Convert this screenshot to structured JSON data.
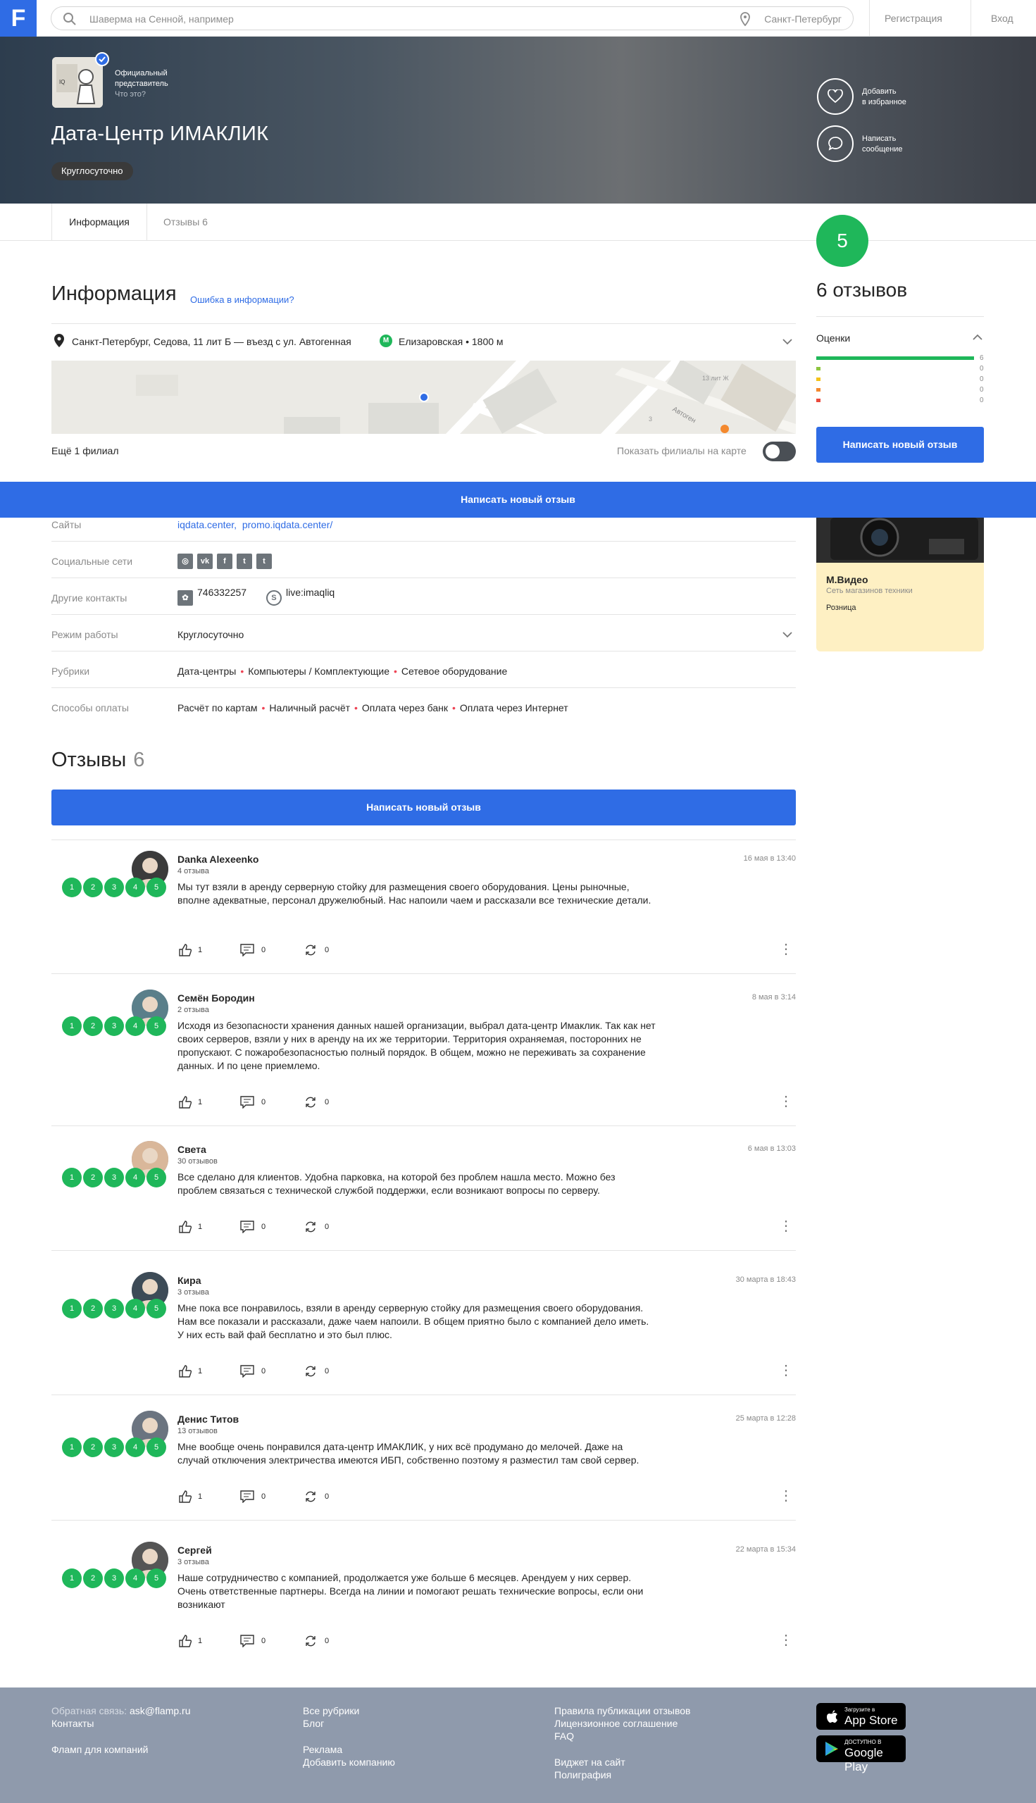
{
  "header": {
    "logo": "F",
    "search_placeholder": "Шаверма на Сенной, например",
    "city": "Санкт-Петербург",
    "register": "Регистрация",
    "login": "Вход"
  },
  "hero": {
    "official_line1": "Официальный",
    "official_line2": "представитель",
    "official_q": "Что это?",
    "title": "Дата-Центр ИМАКЛИК",
    "badge": "Круглосуточно",
    "fav_line1": "Добавить",
    "fav_line2": "в избранное",
    "msg_line1": "Написать",
    "msg_line2": "сообщение"
  },
  "tabs": {
    "info": "Информация",
    "reviews": "Отзывы 6"
  },
  "rating": {
    "score": "5",
    "count_text": "6 отзывов",
    "ocenki": "Оценки",
    "bars": [
      {
        "value": 6,
        "color": "#1fb75a"
      },
      {
        "value": 0,
        "color": "#8dc53e"
      },
      {
        "value": 0,
        "color": "#f4c219"
      },
      {
        "value": 0,
        "color": "#f4892e"
      },
      {
        "value": 0,
        "color": "#ea4a3c"
      }
    ],
    "write": "Написать новый отзыв"
  },
  "info": {
    "heading": "Информация",
    "error_link": "Ошибка в информации?",
    "address": "Санкт-Петербург, Седова, 11 лит Б — въезд с ул. Автогенная",
    "metro_letter": "М",
    "metro": "Елизаровская • 1800 м",
    "map_labels": {
      "lit": "13 лит Ж",
      "street": "Автоген",
      "num": "3"
    },
    "more_branch": "Ещё 1 филиал",
    "show_branches": "Показать филиалы на карте"
  },
  "sticky_write": "Написать новый отзыв",
  "details": {
    "sites_label": "Сайты",
    "site1": "iqdata.center,",
    "site2": "promo.iqdata.center/",
    "social_label": "Социальные сети",
    "social_icons": [
      "instagram-icon",
      "vk-icon",
      "facebook-icon",
      "twitter-icon",
      "twitter-icon"
    ],
    "contacts_label": "Другие контакты",
    "icq": "746332257",
    "skype": "live:imaqliq",
    "hours_label": "Режим работы",
    "hours": "Круглосуточно",
    "rubrics_label": "Рубрики",
    "rubrics": [
      "Дата-центры",
      "Компьютеры / Комплектующие",
      "Сетевое оборудование"
    ],
    "pay_label": "Способы оплаты",
    "payments": [
      "Расчёт по картам",
      "Наличный расчёт",
      "Оплата через банк",
      "Оплата через Интернет"
    ]
  },
  "ad": {
    "name": "М.Видео",
    "sub": "Сеть магазинов техники",
    "tag": "Розница"
  },
  "reviews": {
    "heading": "Отзывы",
    "count": "6",
    "write": "Написать новый отзыв",
    "items": [
      {
        "name": "Danka Alexeenko",
        "count": "4 отзыва",
        "date": "16 мая в 13:40",
        "text": "Мы тут взяли в аренду серверную стойку для размещения своего оборудования. Цены рыночные, вполне адекватные, персонал дружелюбный. Нас напоили чаем и рассказали все технические детали.",
        "likes": "1",
        "comments": "0",
        "shares": "0"
      },
      {
        "name": "Семён Бородин",
        "count": "2 отзыва",
        "date": "8 мая в 3:14",
        "text": "Исходя из безопасности хранения данных нашей организации, выбрал дата-центр Имаклик. Так как нет своих серверов, взяли у них в аренду на их же территории. Территория охраняемая, посторонних не пропускают. С пожаробезопасностью полный порядок. В общем, можно не переживать за сохранение данных. И по цене приемлемо.",
        "likes": "1",
        "comments": "0",
        "shares": "0"
      },
      {
        "name": "Света",
        "count": "30 отзывов",
        "date": "6 мая в 13:03",
        "text": "Все сделано для клиентов. Удобна парковка, на которой без проблем нашла место. Можно без проблем связаться с технической службой поддержки, если возникают вопросы по серверу.",
        "likes": "1",
        "comments": "0",
        "shares": "0"
      },
      {
        "name": "Кира",
        "count": "3 отзыва",
        "date": "30 марта в 18:43",
        "text": "Мне пока все понравилось, взяли в аренду серверную стойку для размещения своего оборудования. Нам все показали и рассказали, даже чаем напоили. В общем приятно было с компанией дело иметь. У них есть вай фай бесплатно и это был плюс.",
        "likes": "1",
        "comments": "0",
        "shares": "0"
      },
      {
        "name": "Денис Титов",
        "count": "13 отзывов",
        "date": "25 марта в 12:28",
        "text": "Мне вообще очень понравился дата-центр ИМАКЛИК, у них всё продумано до мелочей. Даже на случай отключения электричества имеются ИБП, собственно поэтому я разместил там свой сервер.",
        "likes": "1",
        "comments": "0",
        "shares": "0"
      },
      {
        "name": "Сергей",
        "count": "3 отзыва",
        "date": "22 марта в 15:34",
        "text": "Наше сотрудничество с компанией, продолжается уже больше 6 месяцев. Арендуем у них сервер. Очень ответственные партнеры. Всегда на линии и помогают решать технические вопросы, если они возникают",
        "likes": "1",
        "comments": "0",
        "shares": "0"
      }
    ],
    "star_labels": [
      "1",
      "2",
      "3",
      "4",
      "5"
    ]
  },
  "footer": {
    "feedback_label": "Обратная связь:",
    "feedback_email": "ask@flamp.ru",
    "contacts": "Контакты",
    "business": "Фламп для компаний",
    "all_rubrics": "Все рубрики",
    "blog": "Блог",
    "ads": "Реклама",
    "add_company": "Добавить компанию",
    "rules": "Правила публикации отзывов",
    "license": "Лицензионное соглашение",
    "faq": "FAQ",
    "widget": "Виджет на сайт",
    "print": "Полиграфия",
    "appstore_small": "Загрузите в",
    "appstore": "App Store",
    "gplay_small": "ДОСТУПНО В",
    "gplay": "Google Play"
  }
}
